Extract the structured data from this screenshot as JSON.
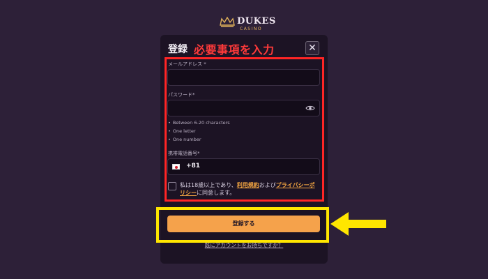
{
  "logo": {
    "brand": "DUKES",
    "sub": "CASINO",
    "icon": "crown-icon"
  },
  "modal": {
    "title": "登録",
    "annotation": "必要事項を入力",
    "close_icon": "close-icon"
  },
  "form": {
    "email_label": "メールアドレス *",
    "email_value": "",
    "password_label": "パスワード*",
    "password_value": "",
    "password_rules": [
      "Between 6-20 characters",
      "One letter",
      "One number"
    ],
    "phone_label": "携帯電話番号*",
    "phone_code": "+81",
    "consent_pre": "私は18歳以上であり、",
    "terms_link": "利用規約",
    "consent_mid": "および",
    "privacy_link": "プライバシーポリシー",
    "consent_post": "に同意します。",
    "submit_label": "登録する",
    "login_link": "既にアカウントをお持ちですか？"
  },
  "colors": {
    "annotation_red": "#ff2525",
    "annotation_yellow": "#ffe600",
    "accent": "#f5a24b",
    "background": "#2d2038"
  }
}
